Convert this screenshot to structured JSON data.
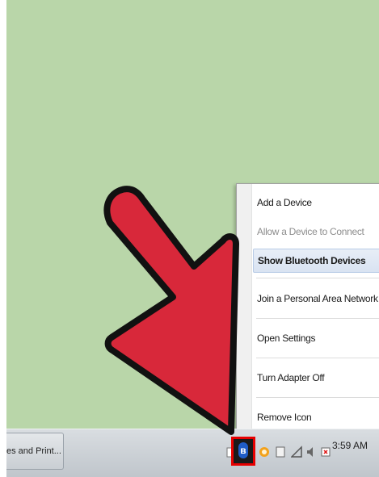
{
  "menu": {
    "items": [
      {
        "label": "Add a Device",
        "state": "normal"
      },
      {
        "label": "Allow a Device to Connect",
        "state": "disabled"
      },
      {
        "label": "Show Bluetooth Devices",
        "state": "highlighted"
      },
      {
        "label": "Join a Personal Area Network",
        "state": "normal"
      },
      {
        "label": "Open Settings",
        "state": "normal"
      },
      {
        "label": "Turn Adapter Off",
        "state": "normal"
      },
      {
        "label": "Remove Icon",
        "state": "normal"
      }
    ]
  },
  "taskbar": {
    "task_button_label": "es and Print...",
    "clock_time": "3:59 AM"
  },
  "tray_icons": [
    "bluetooth-icon",
    "warning-icon",
    "usb-icon",
    "network-icon",
    "volume-icon",
    "flag-icon"
  ],
  "colors": {
    "desktop": "#b9d6a9",
    "arrow_fill": "#d8283a",
    "highlight_border": "#e60000",
    "bluetooth": "#1f5cc7"
  }
}
